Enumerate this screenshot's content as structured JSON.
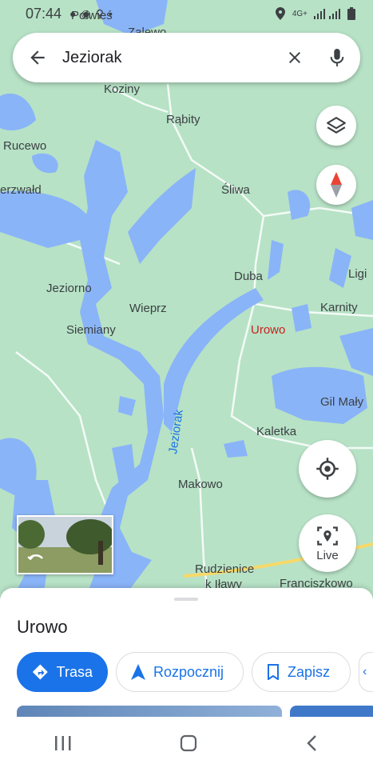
{
  "status_bar": {
    "time": "07:44",
    "network": "4G+"
  },
  "search": {
    "query": "Jeziorak"
  },
  "map": {
    "labels": [
      "Połwieś",
      "Zalewo",
      "Koziny",
      "Rąbity",
      "Rucewo",
      "Śliwa",
      "erzwałd",
      "Duba",
      "Ligi",
      "Jeziorno",
      "Wieprz",
      "Karnity",
      "Siemiany",
      "Urowo",
      "Gil Mały",
      "Kaletka",
      "Makowo",
      "Rudzienice",
      "k Iławy",
      "Franciszkowo"
    ],
    "lake_label": "Jeziorak",
    "live_label": "Live"
  },
  "place": {
    "name": "Urowo"
  },
  "actions": {
    "directions": "Trasa",
    "start": "Rozpocznij",
    "save": "Zapisz"
  },
  "colors": {
    "land": "#b7e2c6",
    "water": "#8ab4f8",
    "accent": "#1a73e8",
    "marker": "#c5221f"
  }
}
